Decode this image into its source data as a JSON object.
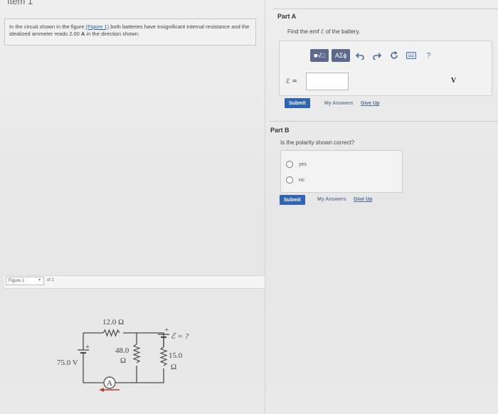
{
  "header": {
    "item_label": "Item 1"
  },
  "problem": {
    "text_before": "In the circuit shown in the figure",
    "figure_link": "(Figure 1)",
    "text_mid": "both batteries have insignificant internal resistance and the idealized ammeter reads 2.00",
    "unit": "A",
    "text_after": "in the direction shown."
  },
  "part_a": {
    "title": "Part A",
    "prompt": "Find the emf ℰ of the battery.",
    "toolbar": {
      "template_label": "■√□",
      "greek_label": "ΑΣϕ",
      "undo_icon": "undo-icon",
      "redo_icon": "redo-icon",
      "reset_icon": "reset-icon",
      "keyboard_icon": "keyboard-icon",
      "help_label": "?"
    },
    "input_label": "ℰ =",
    "input_value": "",
    "unit": "V",
    "submit_label": "Submit",
    "my_answers": "My Answers",
    "give_up": "Give Up"
  },
  "part_b": {
    "title": "Part B",
    "prompt": "Is the polarity shown correct?",
    "options": [
      "yes",
      "no"
    ],
    "submit_label": "Submit",
    "my_answers": "My Answers",
    "give_up": "Give Up"
  },
  "figure_nav": {
    "selected": "Figure 1",
    "of_label": "of 1"
  },
  "circuit": {
    "r_top": "12.0 Ω",
    "r_mid_value": "48.0",
    "r_mid_unit": "Ω",
    "r_right_value": "15.0",
    "r_right_unit": "Ω",
    "battery_left": "75.0 V",
    "battery_right": "ℰ = ?",
    "ammeter": "A",
    "plus": "+"
  }
}
